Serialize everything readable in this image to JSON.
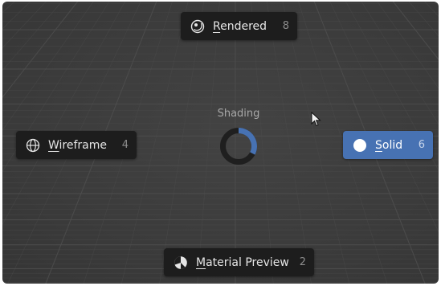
{
  "pie_menu": {
    "title": "Shading",
    "items": [
      {
        "id": "rendered",
        "first_letter": "R",
        "rest": "endered",
        "shortcut": "8",
        "icon": "rendered-sphere-icon",
        "active": false
      },
      {
        "id": "wireframe",
        "first_letter": "W",
        "rest": "ireframe",
        "shortcut": "4",
        "icon": "wireframe-globe-icon",
        "active": false
      },
      {
        "id": "solid",
        "first_letter": "S",
        "rest": "olid",
        "shortcut": "6",
        "icon": "solid-circle-icon",
        "active": true
      },
      {
        "id": "material",
        "first_letter": "M",
        "rest": "aterial Preview",
        "shortcut": "2",
        "icon": "material-preview-icon",
        "active": false
      }
    ],
    "active_direction": "right"
  },
  "colors": {
    "viewport_bg": "#3d3d3d",
    "item_bg": "#1d1d1d",
    "active_bg": "#4772b3",
    "grid_line": "#4d4d4d",
    "ring_dark": "#1f1f1f",
    "ring_accent": "#4772b3"
  }
}
